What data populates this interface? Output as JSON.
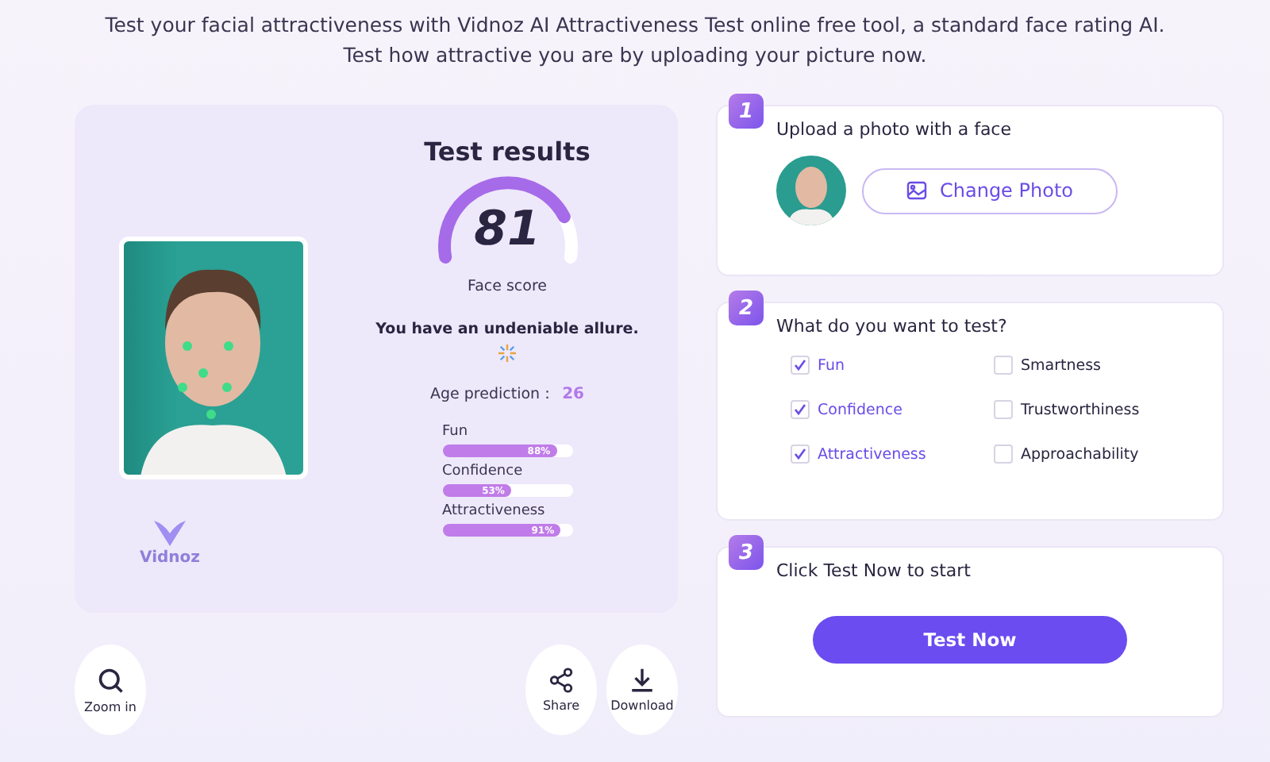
{
  "intro": [
    "Test your facial attractiveness with Vidnoz AI Attractiveness Test online free tool, a standard face rating AI.",
    "Test how attractive you are by uploading your picture now."
  ],
  "result": {
    "title": "Test results",
    "score": "81",
    "level": 0.81,
    "score_label": "Face score",
    "verdict": "You have an undeniable allure.",
    "age_label": "Age prediction：",
    "age": "26",
    "logo": "Vidnoz",
    "traits": [
      {
        "name": "Fun",
        "reading": "88%",
        "level": 0.88
      },
      {
        "name": "Confidence",
        "reading": "53%",
        "level": 0.53
      },
      {
        "name": "Attractiveness",
        "reading": "91%",
        "level": 0.91
      }
    ]
  },
  "actions": [
    {
      "kind": "zoom",
      "label": "Zoom in"
    },
    {
      "kind": "share",
      "label": "Share"
    },
    {
      "kind": "download",
      "label": "Download"
    }
  ],
  "steps": [
    {
      "number": "1",
      "title": "Upload a photo with a face",
      "kind": "upload",
      "button": "Change Photo"
    },
    {
      "number": "2",
      "title": "What do you want to test?",
      "kind": "options",
      "options": [
        {
          "label": "Fun",
          "checked": true
        },
        {
          "label": "Smartness",
          "checked": false
        },
        {
          "label": "Confidence",
          "checked": true
        },
        {
          "label": "Trustworthiness",
          "checked": false
        },
        {
          "label": "Attractiveness",
          "checked": true
        },
        {
          "label": "Approachability",
          "checked": false
        }
      ]
    },
    {
      "number": "3",
      "title": "Click Test Now to start",
      "kind": "start",
      "button": "Test Now"
    }
  ]
}
